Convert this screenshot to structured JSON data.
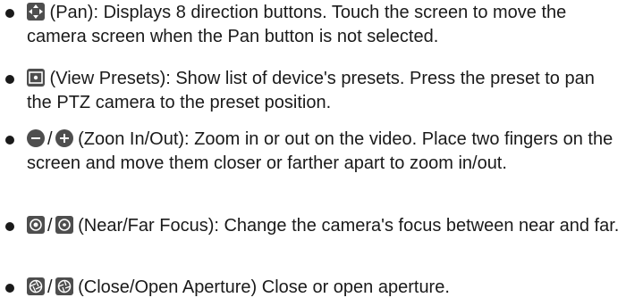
{
  "items": [
    {
      "icon": "pan-arrows-icon",
      "text": " (Pan): Displays 8 direction buttons. Touch the screen to move the camera screen when the Pan button is not selected."
    },
    {
      "icon": "view-presets-icon",
      "text": " (View Presets): Show list of device's presets. Press the preset to pan the PTZ camera to the preset position."
    },
    {
      "icons": [
        "zoom-out-icon",
        "zoom-in-icon"
      ],
      "separator": "/",
      "text": " (Zoon In/Out): Zoom in or out on the video. Place two fingers on the screen and move them closer or farther apart to zoom in/out."
    },
    {
      "icons": [
        "near-focus-icon",
        "far-focus-icon"
      ],
      "separator": "/",
      "text": " (Near/Far Focus): Change the camera's focus between near and far."
    },
    {
      "icons": [
        "close-aperture-icon",
        "open-aperture-icon"
      ],
      "separator": "/",
      "text": " (Close/Open Aperture) Close or open aperture."
    }
  ]
}
